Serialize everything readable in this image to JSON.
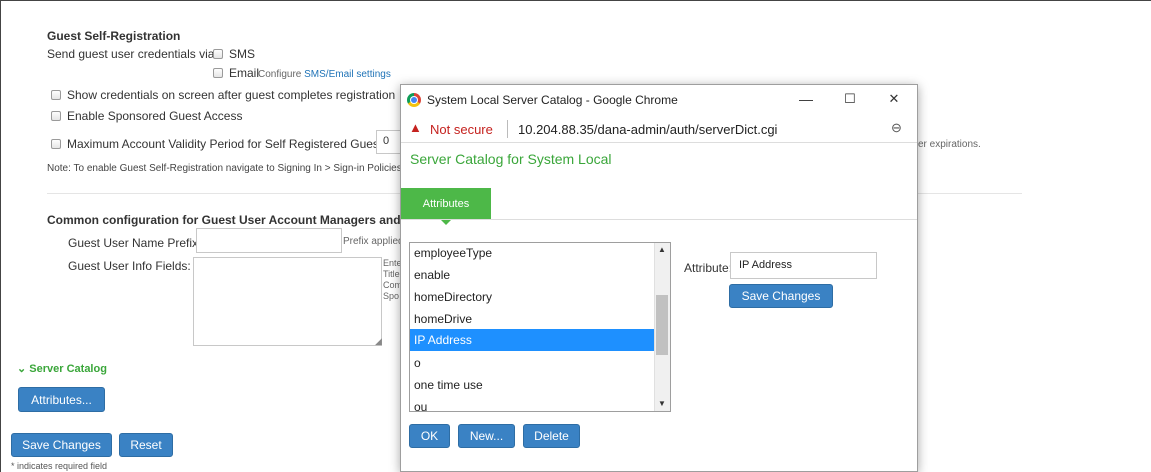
{
  "guest_self_reg": {
    "title": "Guest Self-Registration",
    "send_via_label": "Send guest user credentials via:",
    "sms_label": "SMS",
    "email_label": "Email",
    "configure_prefix": "Configure ",
    "configure_link": "SMS/Email settings",
    "show_credentials_label": "Show credentials on screen after guest completes registration",
    "sponsored_label": "Enable Sponsored Guest Access",
    "max_validity_label": "Maximum Account Validity Period for Self Registered Guests:",
    "max_validity_value": "0",
    "expirations_fragment": "er expirations.",
    "note": "Note: To enable Guest Self-Registration navigate to Signing In > Sign-in Policies >"
  },
  "common_config": {
    "title": "Common configuration for Guest User Account Managers and Gu",
    "prefix_label": "Guest User Name Prefix:",
    "prefix_value": "",
    "prefix_hint": "Prefix applied",
    "info_fields_label": "Guest User Info Fields:",
    "info_hint_lines": [
      "Ente",
      "Title",
      "Com",
      "Spo"
    ]
  },
  "server_catalog": {
    "toggle_label": "Server Catalog",
    "attributes_button": "Attributes..."
  },
  "footer": {
    "save_button": "Save Changes",
    "reset_button": "Reset",
    "required_note": "* indicates required field"
  },
  "popup": {
    "window_title": "System Local Server Catalog - Google Chrome",
    "minimize": "—",
    "maximize": "☐",
    "close": "✕",
    "not_secure": "Not secure",
    "url": "10.204.88.35/dana-admin/auth/serverDict.cgi",
    "heading": "Server Catalog for System Local",
    "tab_label": "Attributes",
    "list_items": [
      "employeeType",
      "enable",
      "homeDirectory",
      "homeDrive",
      "IP Address",
      "o",
      "one time use",
      "ou"
    ],
    "selected_item": "IP Address",
    "attribute_label": "Attribute:",
    "attribute_value": "IP Address",
    "save_button": "Save Changes",
    "ok_button": "OK",
    "new_button": "New...",
    "delete_button": "Delete",
    "colors": {
      "accent_green": "#4db848",
      "button_blue": "#3a82c4",
      "selection_blue": "#1e90ff",
      "heading_green": "#3aa63a"
    }
  }
}
